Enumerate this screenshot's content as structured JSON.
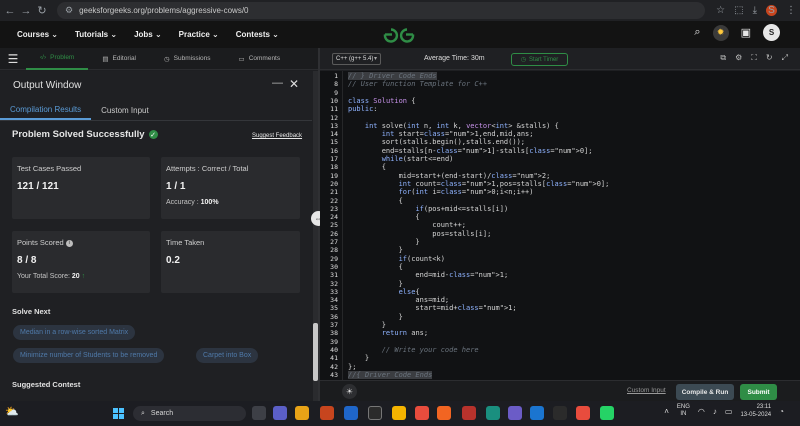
{
  "browser": {
    "url": "geeksforgeeks.org/problems/aggressive-cows/0",
    "profile_initial": "S"
  },
  "navbar": {
    "menu": [
      "Courses",
      "Tutorials",
      "Jobs",
      "Practice",
      "Contests"
    ],
    "user_initial": "S"
  },
  "left_tabs": [
    "Problem",
    "Editorial",
    "Submissions",
    "Comments"
  ],
  "output": {
    "title": "Output Window",
    "tabs": [
      "Compilation Results",
      "Custom Input"
    ],
    "status": "Problem Solved Successfully",
    "feedback": "Suggest Feedback",
    "cards": {
      "test_cases": {
        "label": "Test Cases Passed",
        "value": "121 / 121"
      },
      "attempts": {
        "label": "Attempts : Correct / Total",
        "value": "1 / 1",
        "accuracy_label": "Accuracy :",
        "accuracy_value": "100%"
      },
      "points": {
        "label": "Points Scored",
        "value": "8 / 8",
        "total_label": "Your Total Score:",
        "total_value": "20"
      },
      "time": {
        "label": "Time Taken",
        "value": "0.2"
      }
    },
    "solve_next_title": "Solve Next",
    "solve_next": [
      "Median in a row-wise sorted Matrix",
      "Minimize number of Students to be removed",
      "Carpet into Box"
    ],
    "suggested_title": "Suggested Contest"
  },
  "editor": {
    "language": "C++ (g++ 5.4)",
    "avg_time": "Average Time: 30m",
    "timer": "Start Timer",
    "lines": [
      {
        "n": "1",
        "t": "// } Driver Code Ends",
        "hl": true,
        "cls": "cm"
      },
      {
        "n": "8",
        "t": "// User function Template for C++",
        "cls": "cm"
      },
      {
        "n": "9",
        "t": ""
      },
      {
        "n": "10",
        "t": "class Solution {"
      },
      {
        "n": "11",
        "t": "public:"
      },
      {
        "n": "12",
        "t": ""
      },
      {
        "n": "13",
        "t": "    int solve(int n, int k, vector<int> &stalls) {"
      },
      {
        "n": "14",
        "t": "        int start=1,end,mid,ans;"
      },
      {
        "n": "15",
        "t": "        sort(stalls.begin(),stalls.end());"
      },
      {
        "n": "16",
        "t": "        end=stalls[n-1]-stalls[0];"
      },
      {
        "n": "17",
        "t": "        while(start<=end)"
      },
      {
        "n": "18",
        "t": "        {"
      },
      {
        "n": "19",
        "t": "            mid=start+(end-start)/2;"
      },
      {
        "n": "20",
        "t": "            int count=1,pos=stalls[0];"
      },
      {
        "n": "21",
        "t": "            for(int i=0;i<n;i++)"
      },
      {
        "n": "22",
        "t": "            {"
      },
      {
        "n": "23",
        "t": "                if(pos+mid<=stalls[i])"
      },
      {
        "n": "24",
        "t": "                {"
      },
      {
        "n": "25",
        "t": "                    count++;"
      },
      {
        "n": "26",
        "t": "                    pos=stalls[i];"
      },
      {
        "n": "27",
        "t": "                }"
      },
      {
        "n": "28",
        "t": "            }"
      },
      {
        "n": "29",
        "t": "            if(count<k)"
      },
      {
        "n": "30",
        "t": "            {"
      },
      {
        "n": "31",
        "t": "                end=mid-1;"
      },
      {
        "n": "32",
        "t": "            }"
      },
      {
        "n": "33",
        "t": "            else{"
      },
      {
        "n": "34",
        "t": "                ans=mid;"
      },
      {
        "n": "35",
        "t": "                start=mid+1;"
      },
      {
        "n": "36",
        "t": "            }"
      },
      {
        "n": "37",
        "t": "        }"
      },
      {
        "n": "38",
        "t": "        return ans;"
      },
      {
        "n": "39",
        "t": ""
      },
      {
        "n": "40",
        "t": "        // Write your code here",
        "cls": "cm"
      },
      {
        "n": "41",
        "t": "    }"
      },
      {
        "n": "42",
        "t": "};"
      },
      {
        "n": "43",
        "t": "//{ Driver Code Ends",
        "hl": true,
        "cls": "cm"
      }
    ],
    "custom_input": "Custom Input",
    "compile": "Compile & Run",
    "submit": "Submit"
  },
  "taskbar": {
    "search": "Search",
    "lang_top": "ENG",
    "lang_bottom": "IN",
    "time": "23:11",
    "date": "13-05-2024"
  },
  "colors": {
    "accent_green": "#2f8d46",
    "tab_blue": "#5a9bd6",
    "bg": "#1e1f22"
  }
}
